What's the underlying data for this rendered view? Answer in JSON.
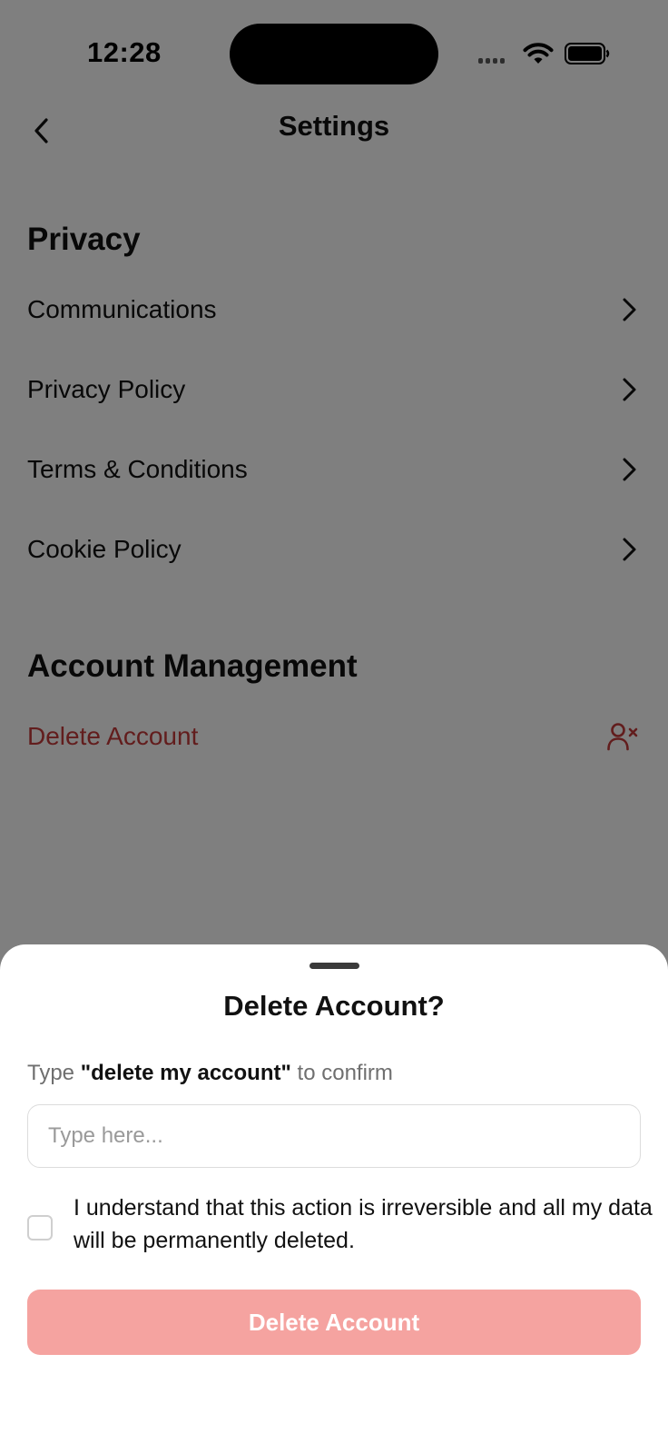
{
  "status_bar": {
    "time": "12:28"
  },
  "header": {
    "title": "Settings",
    "back_icon": "chevron-left-icon"
  },
  "sections": [
    {
      "title": "Privacy",
      "items": [
        {
          "label": "Communications",
          "icon": "chevron-right-icon"
        },
        {
          "label": "Privacy Policy",
          "icon": "chevron-right-icon"
        },
        {
          "label": "Terms & Conditions",
          "icon": "chevron-right-icon"
        },
        {
          "label": "Cookie Policy",
          "icon": "chevron-right-icon"
        }
      ]
    },
    {
      "title": "Account Management",
      "items": [
        {
          "label": "Delete Account",
          "icon": "user-remove-icon",
          "color": "#c53a3a"
        }
      ]
    }
  ],
  "sheet": {
    "title": "Delete Account?",
    "instruction_prefix": "Type",
    "instruction_phrase": "\"delete my account\"",
    "instruction_suffix": "to confirm",
    "input_placeholder": "Type here...",
    "input_value": "",
    "checkbox_checked": false,
    "acknowledgement": "I understand that this action is irreversible and all my data will be permanently deleted.",
    "button_label": "Delete Account",
    "button_color": "#f5a3a0"
  },
  "colors": {
    "danger": "#c53a3a",
    "overlay": "rgba(0,0,0,0.5)"
  }
}
